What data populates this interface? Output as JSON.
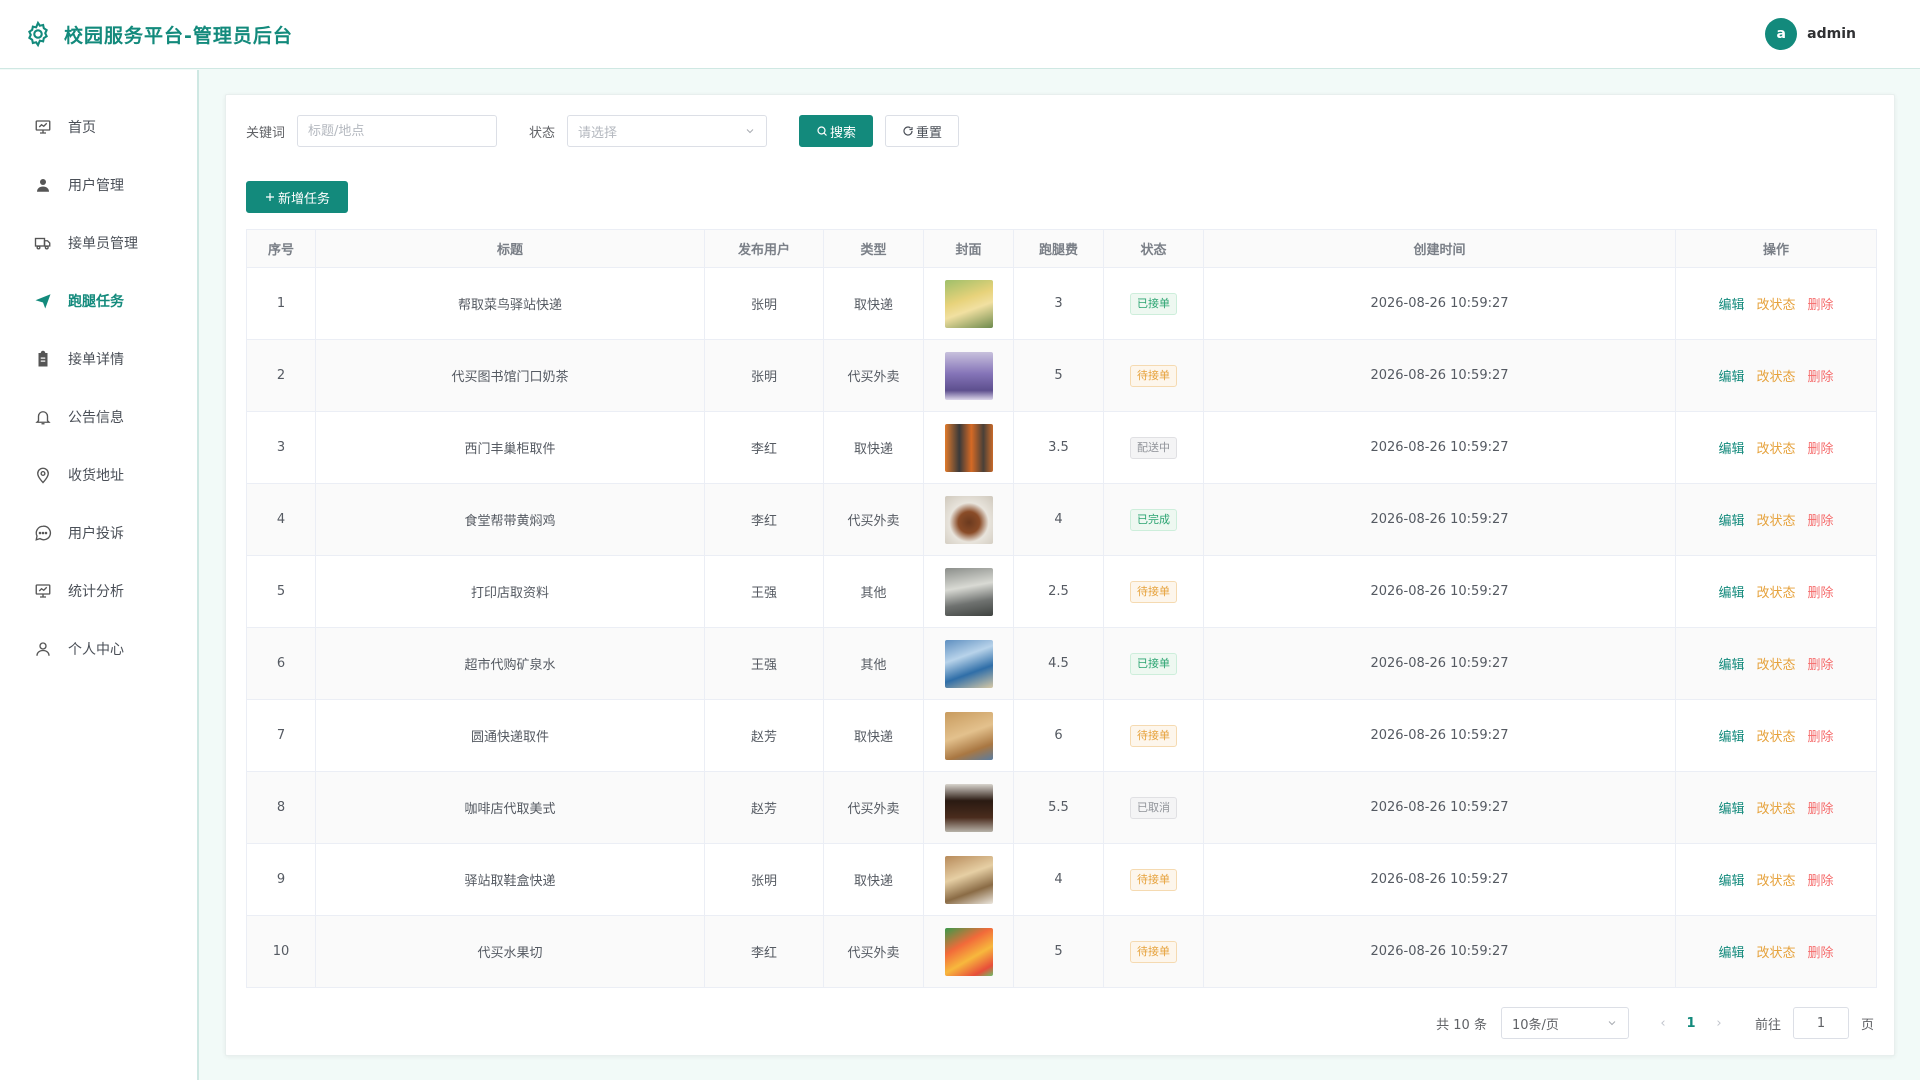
{
  "header": {
    "title": "校园服务平台-管理员后台",
    "avatar_letter": "a",
    "username": "admin"
  },
  "sidebar": {
    "items": [
      {
        "label": "首页",
        "icon": "monitor-icon"
      },
      {
        "label": "用户管理",
        "icon": "user-icon"
      },
      {
        "label": "接单员管理",
        "icon": "truck-icon"
      },
      {
        "label": "跑腿任务",
        "icon": "send-icon",
        "active": true
      },
      {
        "label": "接单详情",
        "icon": "clipboard-icon"
      },
      {
        "label": "公告信息",
        "icon": "bell-icon"
      },
      {
        "label": "收货地址",
        "icon": "location-icon"
      },
      {
        "label": "用户投诉",
        "icon": "chat-icon"
      },
      {
        "label": "统计分析",
        "icon": "chart-icon"
      },
      {
        "label": "个人中心",
        "icon": "user-outline-icon"
      }
    ]
  },
  "filters": {
    "keyword_label": "关键词",
    "keyword_placeholder": "标题/地点",
    "status_label": "状态",
    "status_placeholder": "请选择",
    "search_label": "搜索",
    "reset_label": "重置"
  },
  "add_label": "新增任务",
  "table": {
    "headers": [
      "序号",
      "标题",
      "发布用户",
      "类型",
      "封面",
      "跑腿费",
      "状态",
      "创建时间",
      "操作"
    ],
    "rows": [
      {
        "no": "1",
        "title": "帮取菜鸟驿站快递",
        "user": "张明",
        "type": "取快递",
        "fee": "3",
        "status": "已接单",
        "status_color": "green",
        "time": "2026-08-26 10:59:27"
      },
      {
        "no": "2",
        "title": "代买图书馆门口奶茶",
        "user": "张明",
        "type": "代买外卖",
        "fee": "5",
        "status": "待接单",
        "status_color": "orange",
        "time": "2026-08-26 10:59:27"
      },
      {
        "no": "3",
        "title": "西门丰巢柜取件",
        "user": "李红",
        "type": "取快递",
        "fee": "3.5",
        "status": "配送中",
        "status_color": "grey",
        "time": "2026-08-26 10:59:27"
      },
      {
        "no": "4",
        "title": "食堂帮带黄焖鸡",
        "user": "李红",
        "type": "代买外卖",
        "fee": "4",
        "status": "已完成",
        "status_color": "green",
        "time": "2026-08-26 10:59:27"
      },
      {
        "no": "5",
        "title": "打印店取资料",
        "user": "王强",
        "type": "其他",
        "fee": "2.5",
        "status": "待接单",
        "status_color": "orange",
        "time": "2026-08-26 10:59:27"
      },
      {
        "no": "6",
        "title": "超市代购矿泉水",
        "user": "王强",
        "type": "其他",
        "fee": "4.5",
        "status": "已接单",
        "status_color": "green",
        "time": "2026-08-26 10:59:27"
      },
      {
        "no": "7",
        "title": "圆通快递取件",
        "user": "赵芳",
        "type": "取快递",
        "fee": "6",
        "status": "待接单",
        "status_color": "orange",
        "time": "2026-08-26 10:59:27"
      },
      {
        "no": "8",
        "title": "咖啡店代取美式",
        "user": "赵芳",
        "type": "代买外卖",
        "fee": "5.5",
        "status": "已取消",
        "status_color": "grey",
        "time": "2026-08-26 10:59:27"
      },
      {
        "no": "9",
        "title": "驿站取鞋盒快递",
        "user": "张明",
        "type": "取快递",
        "fee": "4",
        "status": "待接单",
        "status_color": "orange",
        "time": "2026-08-26 10:59:27"
      },
      {
        "no": "10",
        "title": "代买水果切",
        "user": "李红",
        "type": "代买外卖",
        "fee": "5",
        "status": "待接单",
        "status_color": "orange",
        "time": "2026-08-26 10:59:27"
      }
    ],
    "ops": {
      "edit": "编辑",
      "status": "改状态",
      "delete": "删除"
    }
  },
  "pagination": {
    "total": "共 10 条",
    "page_size": "10条/页",
    "current_page": "1",
    "goto_label": "前往",
    "goto_value": "1",
    "page_suffix": "页"
  },
  "colors": {
    "primary": "#138a7c",
    "warning": "#e6a23c",
    "danger": "#f56c6c"
  }
}
